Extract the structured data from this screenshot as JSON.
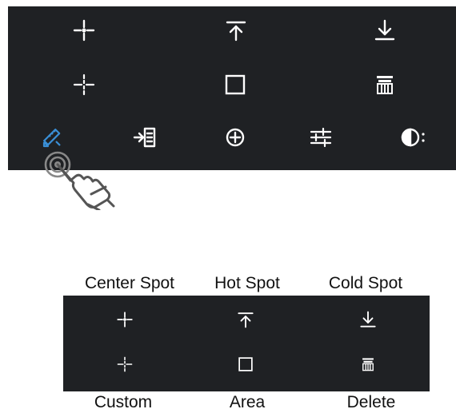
{
  "colors": {
    "panel_bg": "#1f2124",
    "icon_fg": "#ffffff",
    "active_icon": "#3a8fd6",
    "label_text": "#111111",
    "hand_stroke": "#555555"
  },
  "toolbar": {
    "row1": [
      "center-spot-icon",
      "hot-spot-icon",
      "cold-spot-icon"
    ],
    "row2": [
      "custom-spot-icon",
      "area-icon",
      "delete-icon"
    ],
    "row3": [
      "measure-tool-icon",
      "import-icon",
      "target-icon",
      "adjust-sliders-icon",
      "palette-icon"
    ],
    "active": "measure-tool-icon"
  },
  "legend": {
    "top_labels": [
      "Center Spot",
      "Hot Spot",
      "Cold Spot"
    ],
    "bottom_labels": [
      "Custom",
      "Area",
      "Delete"
    ]
  }
}
